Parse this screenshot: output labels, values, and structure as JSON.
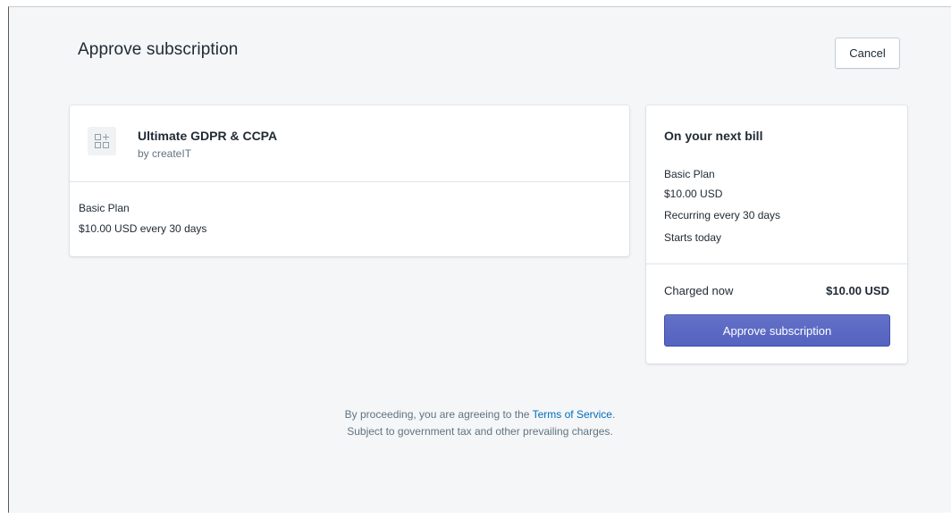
{
  "page": {
    "title": "Approve subscription",
    "cancel_label": "Cancel"
  },
  "app": {
    "name": "Ultimate GDPR & CCPA",
    "author": "by createIT",
    "icon": "app-placeholder-icon",
    "plan_name": "Basic Plan",
    "plan_price": "$10.00 USD every 30 days"
  },
  "bill": {
    "heading": "On your next bill",
    "plan_name": "Basic Plan",
    "price": "$10.00 USD",
    "recurring": "Recurring every 30 days",
    "starts": "Starts today",
    "charged_now_label": "Charged now",
    "charged_now_amount": "$10.00 USD",
    "approve_label": "Approve subscription"
  },
  "footer": {
    "line1_prefix": "By proceeding, you are agreeing to the ",
    "terms_link": "Terms of Service",
    "line1_suffix": ".",
    "line2": "Subject to government tax and other prevailing charges."
  },
  "colors": {
    "background": "#f4f6f8",
    "primary": "#5c6ac4",
    "link": "#006fbb",
    "text": "#212b36",
    "subdued_text": "#637381"
  }
}
